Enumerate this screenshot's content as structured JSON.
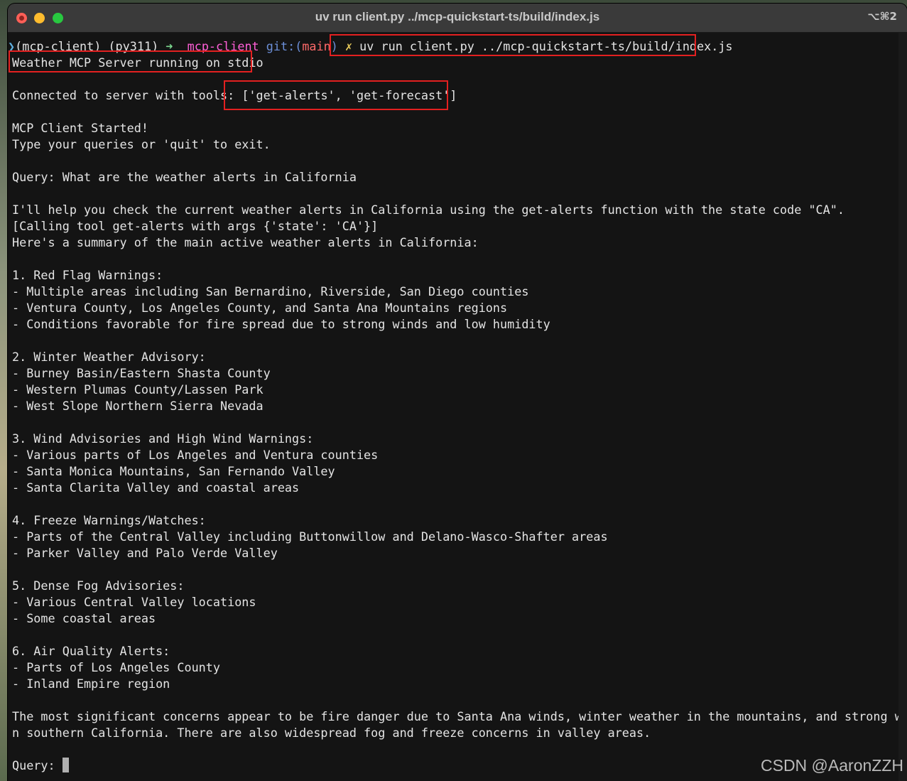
{
  "window": {
    "title": "uv run client.py ../mcp-quickstart-ts/build/index.js",
    "shortcut": "⌥⌘2"
  },
  "prompt": {
    "caret": "❯",
    "env": "(mcp-client) (py311)",
    "arrow": "➜",
    "dir": "mcp-client",
    "git_label": "git:(",
    "branch": "main",
    "git_close": ")",
    "dirty": "✗",
    "command": "uv run client.py ../mcp-quickstart-ts/build/index.js"
  },
  "output": {
    "server_status": "Weather MCP Server running on stdio",
    "connected_prefix": "Connected to server with tools: ",
    "tools": "['get-alerts', 'get-forecast']",
    "started": "MCP Client Started!",
    "instructions": "Type your queries or 'quit' to exit.",
    "query": "Query: What are the weather alerts in California",
    "reply_intro": "I'll help you check the current weather alerts in California using the get-alerts function with the state code \"CA\".",
    "tool_call": "[Calling tool get-alerts with args {'state': 'CA'}]",
    "summary_intro": "Here's a summary of the main active weather alerts in California:",
    "sections": [
      {
        "heading": "1. Red Flag Warnings:",
        "items": [
          "- Multiple areas including San Bernardino, Riverside, San Diego counties",
          "- Ventura County, Los Angeles County, and Santa Ana Mountains regions",
          "- Conditions favorable for fire spread due to strong winds and low humidity"
        ]
      },
      {
        "heading": "2. Winter Weather Advisory:",
        "items": [
          "- Burney Basin/Eastern Shasta County",
          "- Western Plumas County/Lassen Park",
          "- West Slope Northern Sierra Nevada"
        ]
      },
      {
        "heading": "3. Wind Advisories and High Wind Warnings:",
        "items": [
          "- Various parts of Los Angeles and Ventura counties",
          "- Santa Monica Mountains, San Fernando Valley",
          "- Santa Clarita Valley and coastal areas"
        ]
      },
      {
        "heading": "4. Freeze Warnings/Watches:",
        "items": [
          "- Parts of the Central Valley including Buttonwillow and Delano-Wasco-Shafter areas",
          "- Parker Valley and Palo Verde Valley"
        ]
      },
      {
        "heading": "5. Dense Fog Advisories:",
        "items": [
          "- Various Central Valley locations",
          "- Some coastal areas"
        ]
      },
      {
        "heading": "6. Air Quality Alerts:",
        "items": [
          "- Parts of Los Angeles County",
          "- Inland Empire region"
        ]
      }
    ],
    "conclusion_1": "The most significant concerns appear to be fire danger due to Santa Ana winds, winter weather in the mountains, and strong winds i",
    "conclusion_2": "n southern California. There are also widespread fog and freeze concerns in valley areas.",
    "query_prompt": "Query: "
  },
  "watermark": "CSDN @AaronZZH",
  "colors": {
    "highlight_box": "#e32020",
    "terminal_bg": "#141414",
    "prompt_dir": "#ff5fd7",
    "prompt_git": "#6c8fd8",
    "prompt_branch": "#ff6a6a"
  }
}
